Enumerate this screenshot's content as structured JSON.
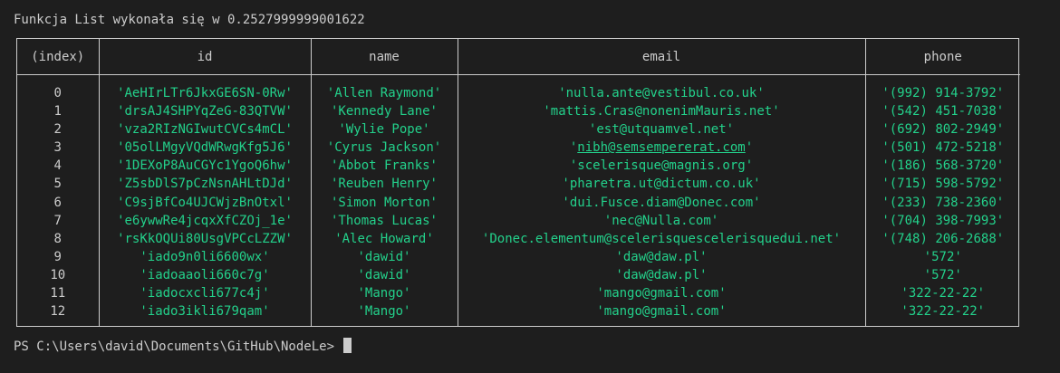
{
  "header": {
    "text": "Funkcja List wykonała się w 0.2527999999001622"
  },
  "table": {
    "columns": [
      "(index)",
      "id",
      "name",
      "email",
      "phone"
    ],
    "rows": [
      {
        "index": "0",
        "id": "'AeHIrLTr6JkxGE6SN-0Rw'",
        "name": "'Allen Raymond'",
        "email": "'nulla.ante@vestibul.co.uk'",
        "phone": "'(992) 914-3792'"
      },
      {
        "index": "1",
        "id": "'drsAJ4SHPYqZeG-83QTVW'",
        "name": "'Kennedy Lane'",
        "email": "'mattis.Cras@nonenimMauris.net'",
        "phone": "'(542) 451-7038'"
      },
      {
        "index": "2",
        "id": "'vza2RIzNGIwutCVCs4mCL'",
        "name": "'Wylie Pope'",
        "email": "'est@utquamvel.net'",
        "phone": "'(692) 802-2949'"
      },
      {
        "index": "3",
        "id": "'05olLMgyVQdWRwgKfg5J6'",
        "name": "'Cyrus Jackson'",
        "email": "'nibh@semsempererat.com'",
        "phone": "'(501) 472-5218'"
      },
      {
        "index": "4",
        "id": "'1DEXoP8AuCGYc1YgoQ6hw'",
        "name": "'Abbot Franks'",
        "email": "'scelerisque@magnis.org'",
        "phone": "'(186) 568-3720'"
      },
      {
        "index": "5",
        "id": "'Z5sbDlS7pCzNsnAHLtDJd'",
        "name": "'Reuben Henry'",
        "email": "'pharetra.ut@dictum.co.uk'",
        "phone": "'(715) 598-5792'"
      },
      {
        "index": "6",
        "id": "'C9sjBfCo4UJCWjzBnOtxl'",
        "name": "'Simon Morton'",
        "email": "'dui.Fusce.diam@Donec.com'",
        "phone": "'(233) 738-2360'"
      },
      {
        "index": "7",
        "id": "'e6ywwRe4jcqxXfCZOj_1e'",
        "name": "'Thomas Lucas'",
        "email": "'nec@Nulla.com'",
        "phone": "'(704) 398-7993'"
      },
      {
        "index": "8",
        "id": "'rsKkOQUi80UsgVPCcLZZW'",
        "name": "'Alec Howard'",
        "email": "'Donec.elementum@scelerisquescelerisquedui.net'",
        "phone": "'(748) 206-2688'"
      },
      {
        "index": "9",
        "id": "'iado9n0li6600wx'",
        "name": "'dawid'",
        "email": "'daw@daw.pl'",
        "phone": "'572'"
      },
      {
        "index": "10",
        "id": "'iadoaaoli660c7g'",
        "name": "'dawid'",
        "email": "'daw@daw.pl'",
        "phone": "'572'"
      },
      {
        "index": "11",
        "id": "'iadocxcli677c4j'",
        "name": "'Mango'",
        "email": "'mango@gmail.com'",
        "phone": "'322-22-22'"
      },
      {
        "index": "12",
        "id": "'iado3ikli679qam'",
        "name": "'Mango'",
        "email": "'mango@gmail.com'",
        "phone": "'322-22-22'"
      }
    ]
  },
  "prompt": {
    "text": "PS C:\\Users\\david\\Documents\\GitHub\\NodeLe> "
  },
  "colors": {
    "background": "#1e1e1e",
    "text": "#cccccc",
    "string": "#23d18b"
  }
}
